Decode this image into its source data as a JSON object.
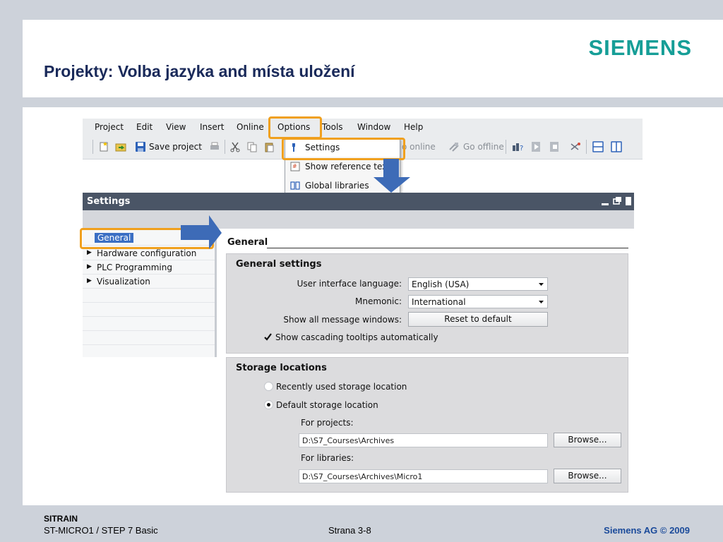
{
  "slide": {
    "title": "Projekty: Volba jazyka and místa uložení",
    "logo": "SIEMENS",
    "footer": {
      "brand": "SITRAIN",
      "course": "ST-MICRO1 / STEP 7 Basic",
      "page": "Strana 3-8",
      "copyright": "Siemens AG © 2009"
    },
    "colors": {
      "logo": "#169e97",
      "title": "#1a2a5a",
      "highlight": "#f0a01e",
      "callout": "#3d6bb7",
      "band": "#cdd2da"
    }
  },
  "menubar": {
    "items": [
      "Project",
      "Edit",
      "View",
      "Insert",
      "Online",
      "Options",
      "Tools",
      "Window",
      "Help"
    ],
    "highlighted": "Options"
  },
  "toolbar": {
    "save_label": "Save project",
    "go_online": "o online",
    "go_offline": "Go offline",
    "icons": [
      "new-project-icon",
      "open-project-icon",
      "save-icon",
      "print-icon",
      "cut-icon",
      "copy-icon",
      "paste-icon",
      "go-online-icon",
      "go-offline-icon",
      "accessible-devices-icon",
      "start-simulation-icon",
      "stop-simulation-icon",
      "cross-reference-icon",
      "split-horizontal-icon",
      "split-vertical-icon"
    ]
  },
  "options_menu": {
    "items": [
      {
        "label": "Settings",
        "icon": "wrench-icon"
      },
      {
        "label": "Show reference tex",
        "icon": "reference-text-icon"
      },
      {
        "label": "Global libraries",
        "icon": "book-icon"
      }
    ]
  },
  "settings": {
    "window_title": "Settings",
    "nav": [
      {
        "label": "General",
        "selected": true,
        "expandable": false
      },
      {
        "label": "Hardware configuration",
        "selected": false,
        "expandable": true
      },
      {
        "label": "PLC Programming",
        "selected": false,
        "expandable": true
      },
      {
        "label": "Visualization",
        "selected": false,
        "expandable": true
      }
    ],
    "section_title": "General",
    "general_settings": {
      "title": "General settings",
      "ui_language_label": "User interface language:",
      "ui_language_value": "English (USA)",
      "mnemonic_label": "Mnemonic:",
      "mnemonic_value": "International",
      "message_windows_label": "Show all message windows:",
      "reset_button": "Reset to default",
      "cascading_tooltips_label": "Show cascading tooltips automatically",
      "cascading_tooltips_checked": true
    },
    "storage": {
      "title": "Storage locations",
      "recent_label": "Recently used storage location",
      "recent_selected": false,
      "default_label": "Default storage location",
      "default_selected": true,
      "projects_label": "For projects:",
      "projects_path": "D:\\S7_Courses\\Archives",
      "libraries_label": "For libraries:",
      "libraries_path": "D:\\S7_Courses\\Archives\\Micro1",
      "browse_label": "Browse..."
    }
  }
}
